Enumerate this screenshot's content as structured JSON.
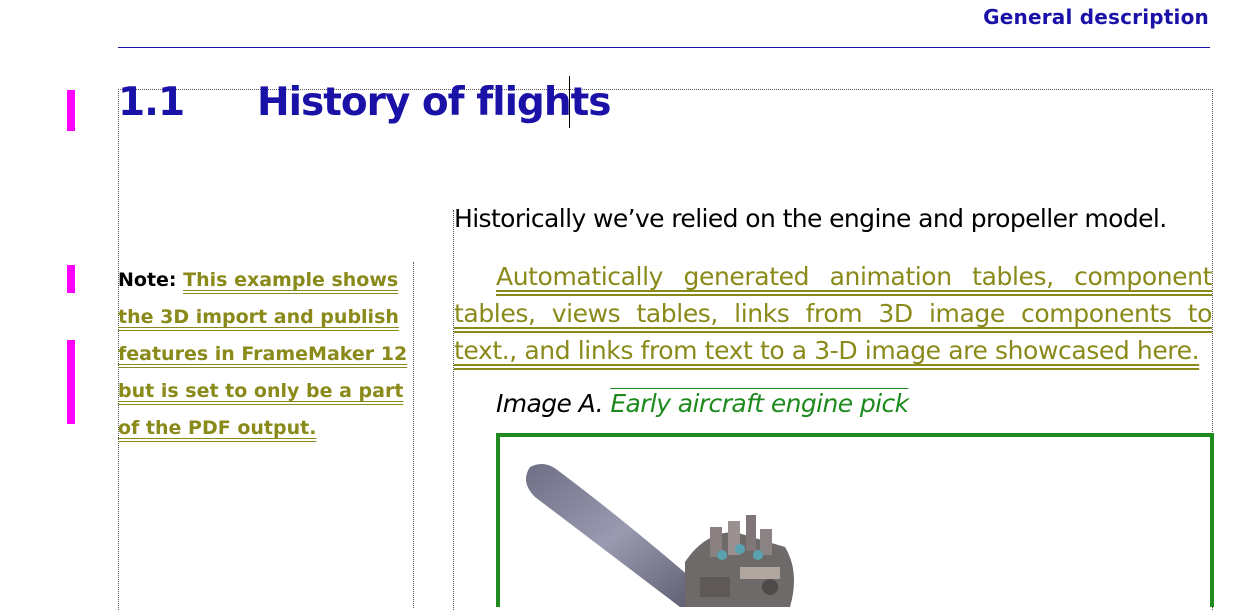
{
  "running_header": "General description",
  "heading": {
    "number": "1.1",
    "title": "History of flights"
  },
  "intro": "Historically we’ve relied on the engine and propeller model.",
  "note": {
    "label": "Note:",
    "text": "This example shows the 3D import and publish features in FrameMaker 12 but is set to only be a part of the PDF output."
  },
  "auto_paragraph": "Automatically generated animation tables, component tables, views tables, links from 3D image components to text., and links from text to a 3-D image are showcased here.",
  "figure": {
    "label": "Image A.",
    "title": "Early aircraft engine pick"
  },
  "colors": {
    "heading": "#1a12a6",
    "conditional_text": "#8a8a1a",
    "link": "#1e8a1e",
    "change_bar": "#ff00ff",
    "image_border": "#1f8a1f"
  }
}
